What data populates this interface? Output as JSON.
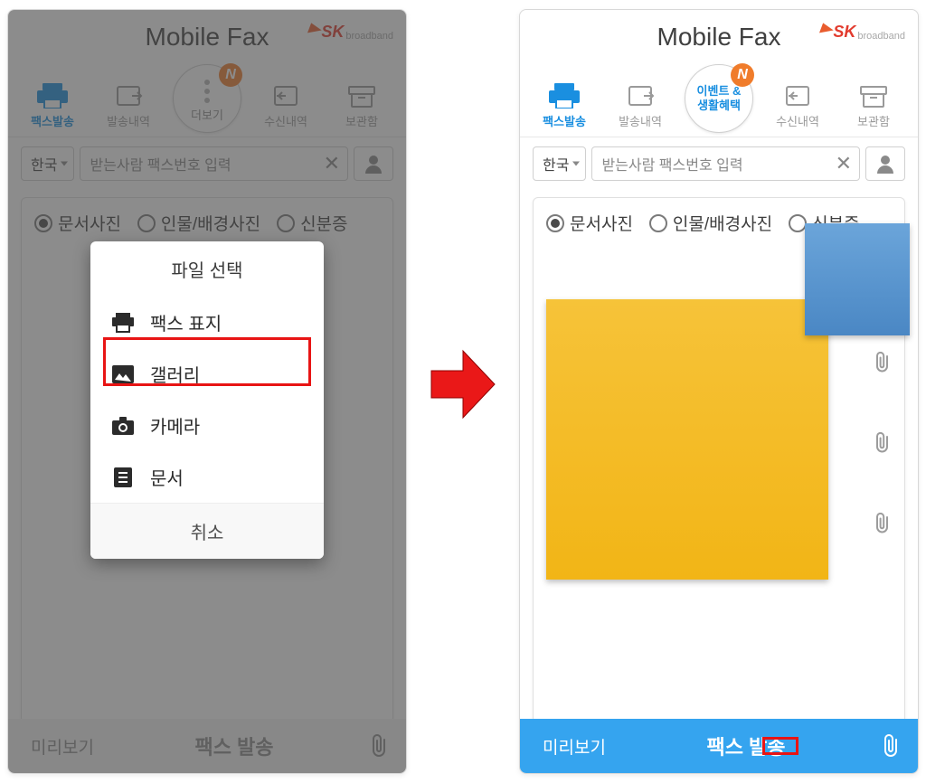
{
  "app_title": "Mobile Fax",
  "logo": {
    "sk": "SK",
    "broadband": "broadband"
  },
  "tabs": {
    "send": "팩스발송",
    "sent": "발송내역",
    "more": "더보기",
    "center_line1": "이벤트 &",
    "center_line2": "생활혜택",
    "recv": "수신내역",
    "box": "보관함",
    "badge": "N"
  },
  "input": {
    "country": "한국",
    "placeholder": "받는사람 팩스번호 입력"
  },
  "doctype": {
    "doc": "문서사진",
    "person": "인물/배경사진",
    "id": "신분증"
  },
  "bottom": {
    "preview": "미리보기",
    "send": "팩스 발송"
  },
  "dialog": {
    "title": "파일 선택",
    "cover": "팩스 표지",
    "gallery": "갤러리",
    "camera": "카메라",
    "doc": "문서",
    "cancel": "취소"
  }
}
